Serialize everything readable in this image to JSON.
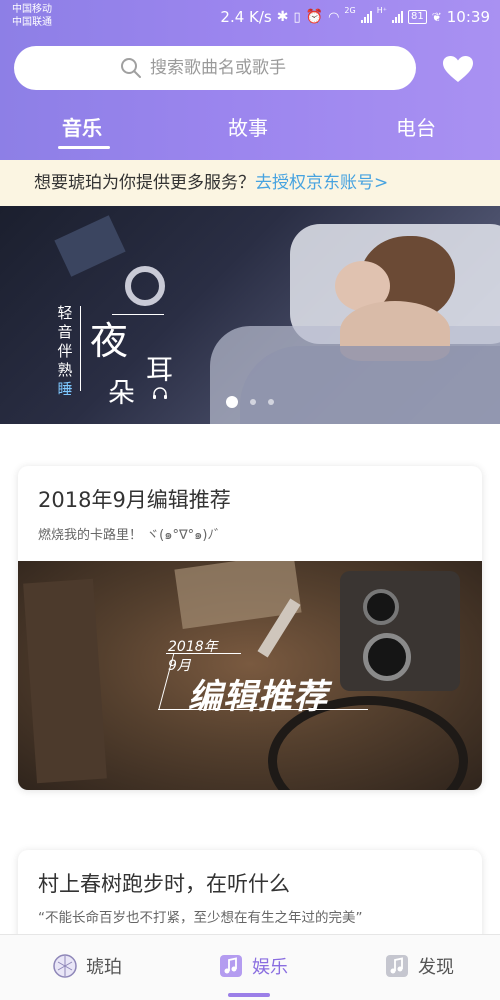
{
  "status_bar": {
    "carrier_1": "中国移动",
    "carrier_2": "中国联通",
    "speed": "2.4 K/s",
    "net_1": "2G",
    "net_2": "H⁺",
    "battery": "81",
    "time": "10:39"
  },
  "header": {
    "search_placeholder": "搜索歌曲名或歌手",
    "tabs": [
      {
        "label": "音乐",
        "active": true
      },
      {
        "label": "故事",
        "active": false
      },
      {
        "label": "电台",
        "active": false
      }
    ]
  },
  "notice": {
    "text": "想要琥珀为你提供更多服务？",
    "link": "去授权京东账号>"
  },
  "banner": {
    "vertical_text": [
      "轻",
      "音",
      "伴",
      "熟"
    ],
    "vertical_text_highlight": "睡",
    "title_big": "夜",
    "title_small_1": "耳",
    "title_small_2": "朵",
    "page_count": 3,
    "active_page": 0
  },
  "cards": [
    {
      "title": "2018年9月编辑推荐",
      "subtitle": "燃烧我的卡路里！ ヾ(๑°∇°๑)ﾉ゛",
      "image_text": {
        "year": "2018年",
        "month": "9月",
        "big": "编辑推荐"
      }
    },
    {
      "title": "村上春树跑步时，在听什么",
      "subtitle": "“不能长命百岁也不打紧，至少想在有生之年过的完美”"
    }
  ],
  "bottom_nav": [
    {
      "label": "琥珀",
      "icon": "amber-ball-icon",
      "active": false
    },
    {
      "label": "娱乐",
      "icon": "music-note-icon",
      "active": true
    },
    {
      "label": "发现",
      "icon": "music-note-icon",
      "active": false
    }
  ],
  "colors": {
    "header_gradient_start": "#8d7fe6",
    "header_gradient_end": "#a991f2",
    "notice_bg": "#fbf5e2",
    "link": "#47a3e0",
    "accent": "#8a6ee0"
  }
}
